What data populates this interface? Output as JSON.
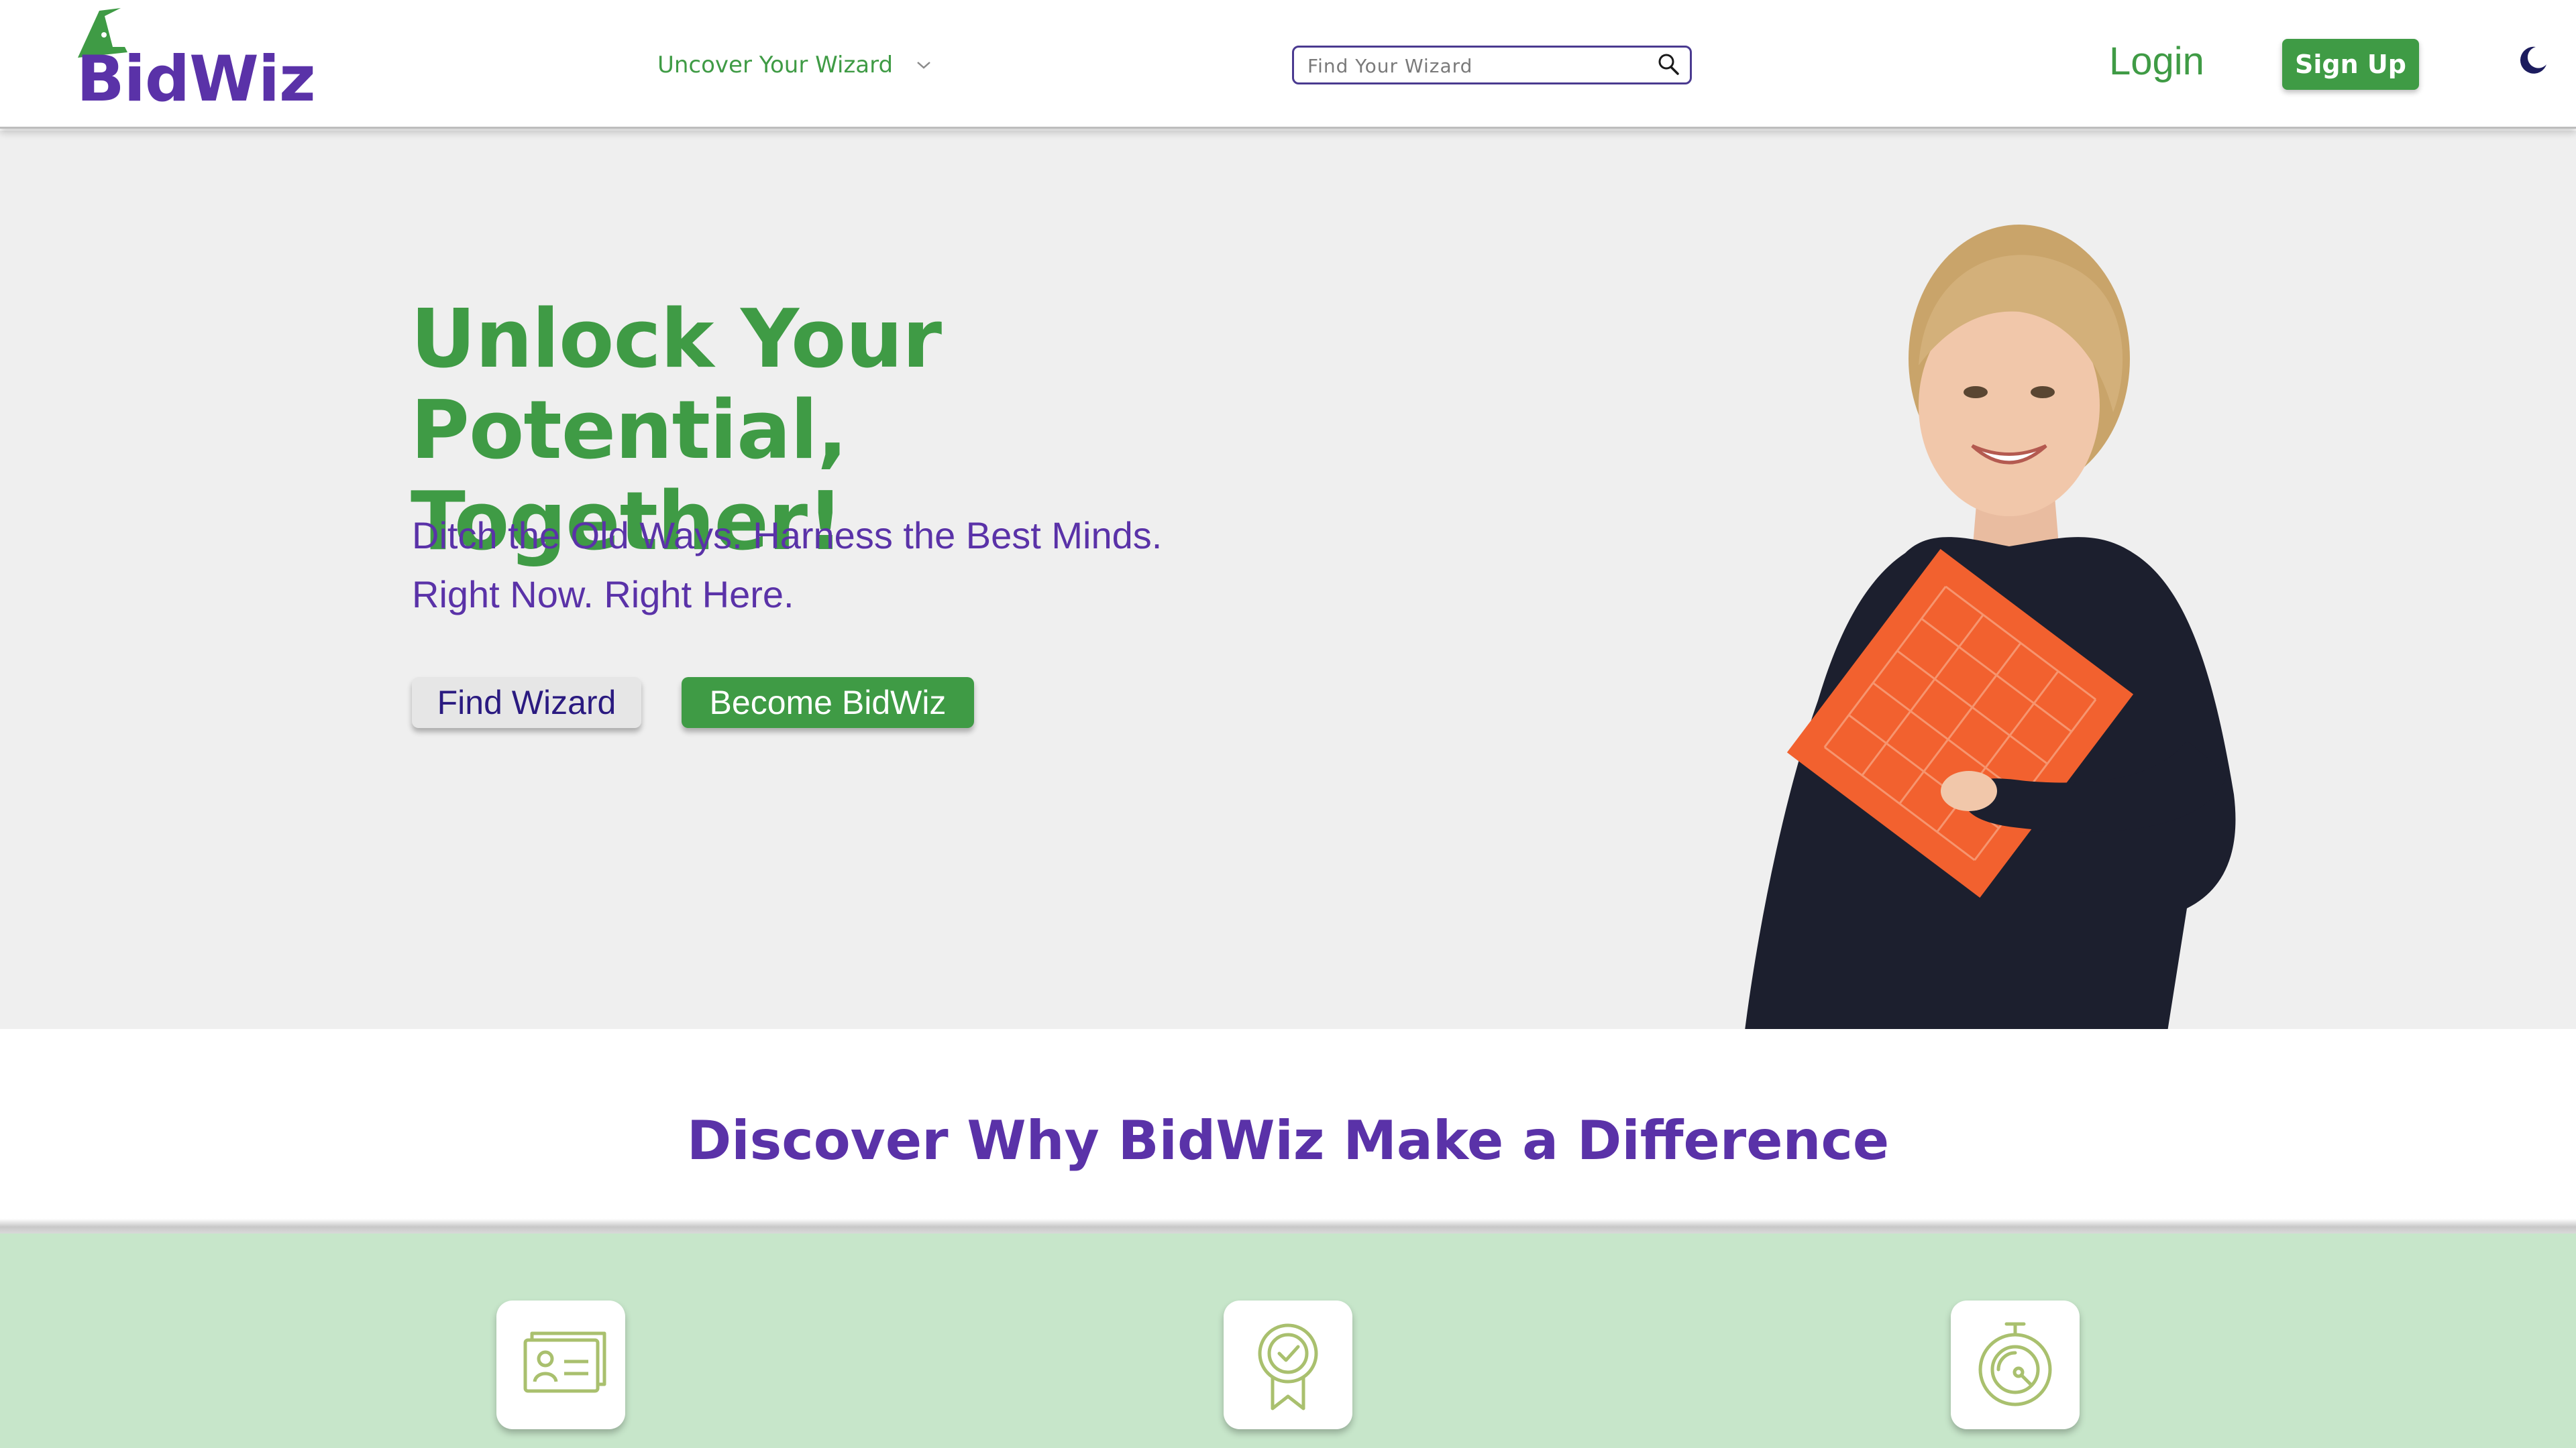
{
  "header": {
    "logo_text": "BidWiz",
    "nav_dropdown_label": "Uncover Your Wizard",
    "search_placeholder": "Find Your Wizard",
    "login_label": "Login",
    "signup_label": "Sign Up",
    "theme_toggle_icon": "moon-icon"
  },
  "hero": {
    "title_line1": "Unlock Your Potential,",
    "title_line2": "Together!",
    "subtitle_line1": "Ditch the Old Ways. Harness the Best Minds.",
    "subtitle_line2": "Right Now. Right Here.",
    "find_button_label": "Find Wizard",
    "become_button_label": "Become BidWiz"
  },
  "discover": {
    "title": "Discover Why BidWiz Make a Difference"
  },
  "features": {
    "icons": [
      "profile-card-icon",
      "award-badge-icon",
      "stopwatch-icon"
    ]
  },
  "colors": {
    "brand_green": "#3f9b45",
    "brand_purple": "#5a32a8",
    "hero_bg": "#efefef",
    "features_bg": "#c7e6ca",
    "icon_olive": "#a9c06e"
  }
}
